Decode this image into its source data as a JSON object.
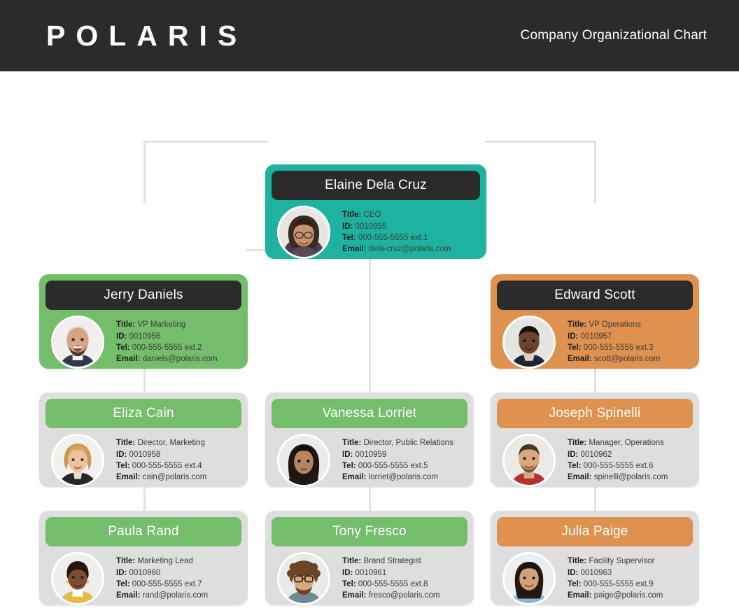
{
  "header": {
    "brand": "POLARIS",
    "subtitle": "Company Organizational Chart"
  },
  "labels": {
    "title": "Title:",
    "id": "ID:",
    "tel": "Tel:",
    "email": "Email:"
  },
  "colors": {
    "header_bar": "#2b2b2b",
    "teal": "#1eb3a0",
    "green": "#74bd6b",
    "orange": "#df924f",
    "grey_card": "#dedede",
    "connector": "#e2e2e2"
  },
  "nodes": [
    {
      "key": "ceo",
      "name": "Elaine Dela Cruz",
      "title": "CEO",
      "id": "0010955",
      "tel": "000-555-5555 ext.1",
      "email": "dela-cruz@polaris.com",
      "avatar": "photo-elaine-dela-cruz"
    },
    {
      "key": "vp-marketing",
      "name": "Jerry Daniels",
      "title": "VP Marketing",
      "id": "0010956",
      "tel": "000-555-5555 ext.2",
      "email": "daniels@polaris.com",
      "avatar": "photo-jerry-daniels"
    },
    {
      "key": "vp-operations",
      "name": "Edward Scott",
      "title": "VP Operations",
      "id": "0010957",
      "tel": "000-555-5555 ext.3",
      "email": "scott@polaris.com",
      "avatar": "photo-edward-scott"
    },
    {
      "key": "director-marketing",
      "name": "Eliza Cain",
      "title": "Director, Marketing",
      "id": "0010958",
      "tel": "000-555-5555 ext.4",
      "email": "cain@polaris.com",
      "avatar": "photo-eliza-cain"
    },
    {
      "key": "director-pr",
      "name": "Vanessa Lorriet",
      "title": "Director, Public Relations",
      "id": "0010959",
      "tel": "000-555-5555 ext.5",
      "email": "lorriet@polaris.com",
      "avatar": "photo-vanessa-lorriet"
    },
    {
      "key": "manager-operations",
      "name": "Joseph Spinelli",
      "title": "Manager, Operations",
      "id": "0010962",
      "tel": "000-555-5555 ext.6",
      "email": "spinelli@polaris.com",
      "avatar": "photo-joseph-spinelli"
    },
    {
      "key": "marketing-lead",
      "name": "Paula Rand",
      "title": "Marketing Lead",
      "id": "0010960",
      "tel": "000-555-5555 ext.7",
      "email": "rand@polaris.com",
      "avatar": "photo-paula-rand"
    },
    {
      "key": "brand-strategist",
      "name": "Tony Fresco",
      "title": "Brand Strategist",
      "id": "0010961",
      "tel": "000-555-5555 ext.8",
      "email": "fresco@polaris.com",
      "avatar": "photo-tony-fresco"
    },
    {
      "key": "facility-supervisor",
      "name": "Julia Paige",
      "title": "Facility Supervisor",
      "id": "0010963",
      "tel": "000-555-5555 ext.9",
      "email": "paige@polaris.com",
      "avatar": "photo-julia-paige"
    }
  ]
}
